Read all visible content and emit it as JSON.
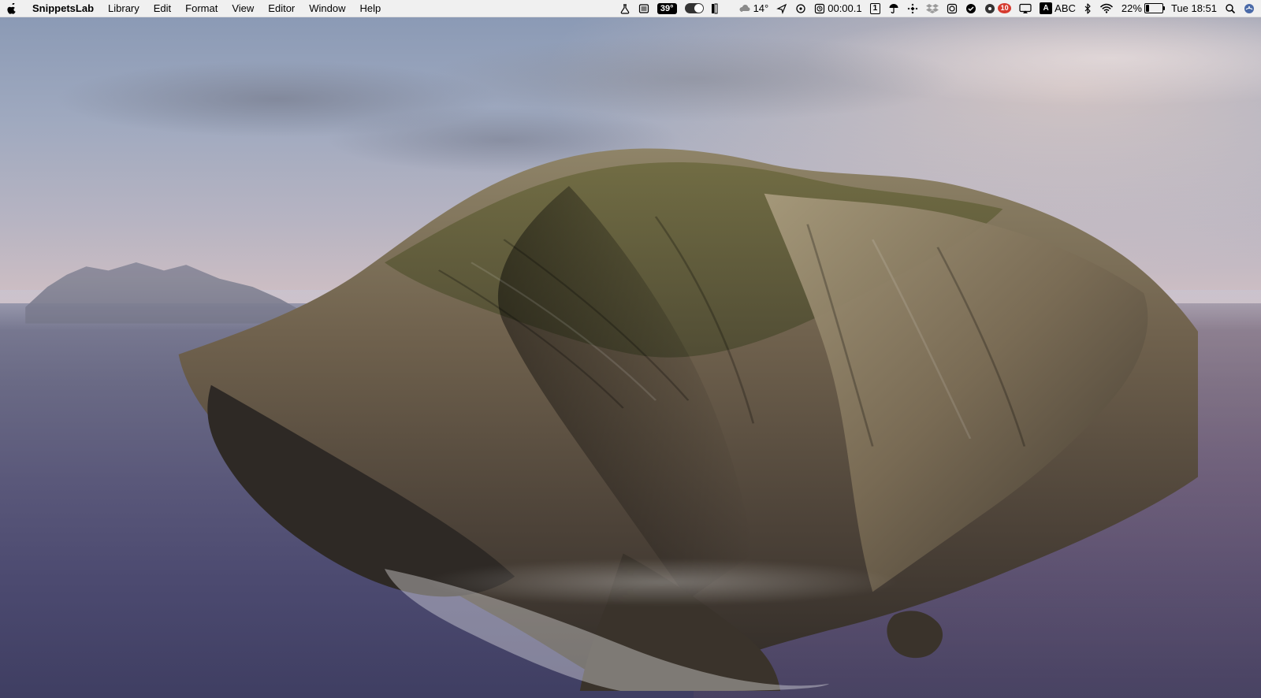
{
  "menubar": {
    "app_name": "SnippetsLab",
    "items": [
      "Library",
      "Edit",
      "Format",
      "View",
      "Editor",
      "Window",
      "Help"
    ]
  },
  "status": {
    "cpu_temp": "39°",
    "weather_temp": "14°",
    "timer": "00:00.1",
    "desktop_number": "1",
    "input_mode_letter": "A",
    "input_source": "ABC",
    "battery_percent_text": "22%",
    "battery_fill_percent": 22,
    "notification_count": "10",
    "clock": "Tue 18:51"
  }
}
